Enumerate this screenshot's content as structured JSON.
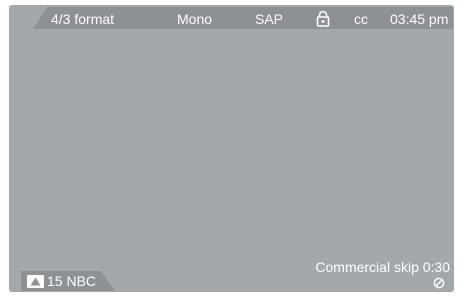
{
  "status_bar": {
    "format": "4/3 format",
    "audio": "Mono",
    "sap": "SAP",
    "lock_icon": "lock-icon",
    "captions": "cc",
    "time": "03:45 pm"
  },
  "channel": {
    "icon": "antenna-icon",
    "label": "15 NBC"
  },
  "commercial_skip": {
    "label": "Commercial skip 0:30",
    "icon": "skip-icon"
  },
  "colors": {
    "screen": "#a3a8ab",
    "bar": "#8d9194",
    "text": "#ffffff"
  }
}
